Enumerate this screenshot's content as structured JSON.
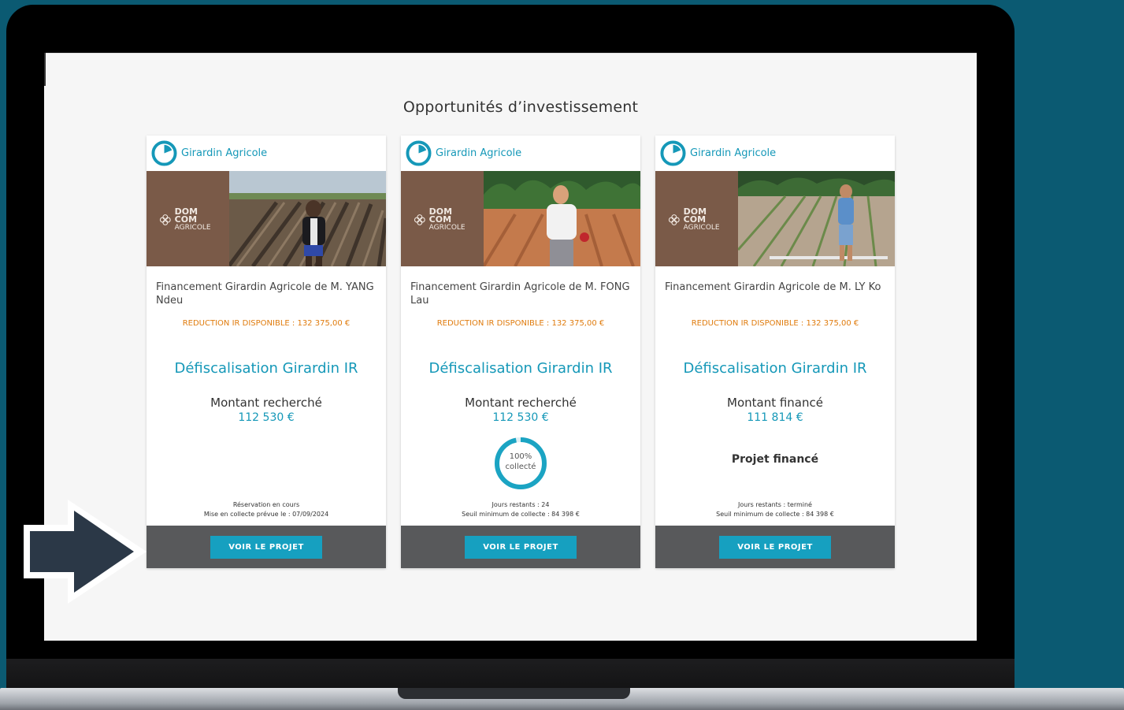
{
  "page": {
    "title": "Opportunités d’investissement"
  },
  "colors": {
    "background": "#0b5a72",
    "accent": "#1598b8",
    "reduction": "#e07c0e",
    "footer": "#58595b",
    "button": "#16a0c0",
    "brand_brown": "#7a5a48"
  },
  "logo_text": {
    "line1": "DOM COM",
    "line2": "AGRICOLE"
  },
  "cards": [
    {
      "brand": "Girardin Agricole",
      "brand_icon": "pie-chart-icon",
      "description": "Financement Girardin Agricole de M. YANG Ndeu",
      "reduction": "REDUCTION IR DISPONIBLE : 132 375,00 €",
      "product": "Défiscalisation Girardin IR",
      "amount_label": "Montant recherché",
      "amount": "112 530 €",
      "info_line1": "Réservation en cours",
      "info_line2": "Mise en collecte prévue le : 07/09/2024",
      "button": "VOIR LE PROJET"
    },
    {
      "brand": "Girardin Agricole",
      "brand_icon": "pie-chart-icon",
      "description": "Financement Girardin Agricole de M. FONG Lau",
      "reduction": "REDUCTION IR DISPONIBLE : 132 375,00 €",
      "product": "Défiscalisation Girardin IR",
      "amount_label": "Montant recherché",
      "amount": "112 530 €",
      "progress_percent": "100%",
      "progress_label": "collecté",
      "progress_value": 100,
      "info_line1": "Jours restants : 24",
      "info_line2": "Seuil minimum de collecte : 84 398 €",
      "button": "VOIR LE PROJET"
    },
    {
      "brand": "Girardin Agricole",
      "brand_icon": "pie-chart-icon",
      "description": "Financement Girardin Agricole de M. LY Ko",
      "reduction": "REDUCTION IR DISPONIBLE : 132 375,00 €",
      "product": "Défiscalisation Girardin IR",
      "amount_label": "Montant financé",
      "amount": "111 814 €",
      "status": "Projet financé",
      "info_line1": "Jours restants : terminé",
      "info_line2": "Seuil minimum de collecte : 84 398 €",
      "button": "VOIR LE PROJET"
    }
  ],
  "annotation": {
    "icon": "arrow-right-icon"
  }
}
